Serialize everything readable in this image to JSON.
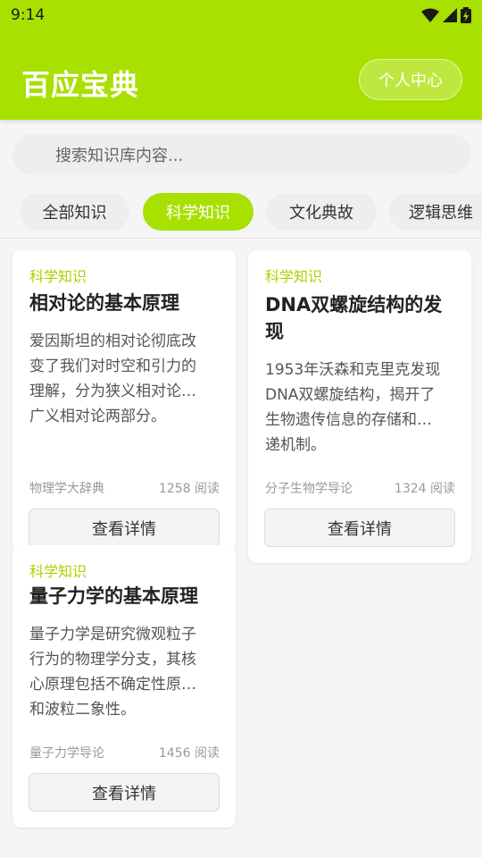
{
  "status_bar": {
    "time": "9:14"
  },
  "header": {
    "title": "百应宝典",
    "profile_label": "个人中心"
  },
  "search": {
    "placeholder": "搜索知识库内容..."
  },
  "tabs": [
    {
      "label": "全部知识",
      "active": false
    },
    {
      "label": "科学知识",
      "active": true
    },
    {
      "label": "文化典故",
      "active": false
    },
    {
      "label": "逻辑思维",
      "active": false
    }
  ],
  "cards": [
    {
      "category": "科学知识",
      "title": "相对论的基本原理",
      "desc_lines": [
        "爱因斯坦的相对论彻底改",
        "变了我们对时空和引力的",
        "理解，分为狭义相对论…",
        "广义相对论两部分。"
      ],
      "source": "物理学大辞典",
      "reads": "1258 阅读",
      "button": "查看详情"
    },
    {
      "category": "科学知识",
      "title_lines": [
        "DNA双螺旋结构的发",
        "现"
      ],
      "desc_lines": [
        "1953年沃森和克里克发现",
        "DNA双螺旋结构，揭开了",
        "生物遗传信息的存储和…",
        "递机制。"
      ],
      "source": "分子生物学导论",
      "reads": "1324 阅读",
      "button": "查看详情"
    },
    {
      "category": "科学知识",
      "title": "量子力学的基本原理",
      "desc_lines": [
        "量子力学是研究微观粒子",
        "行为的物理学分支，其核",
        "心原理包括不确定性原…",
        "和波粒二象性。"
      ],
      "source": "量子力学导论",
      "reads": "1456 阅读",
      "button": "查看详情"
    }
  ],
  "colors": {
    "accent": "#a8e000",
    "category": "#a8d400"
  },
  "icons": {
    "search": "search-icon",
    "wifi": "wifi-icon",
    "signal": "signal-icon",
    "battery": "battery-icon"
  }
}
